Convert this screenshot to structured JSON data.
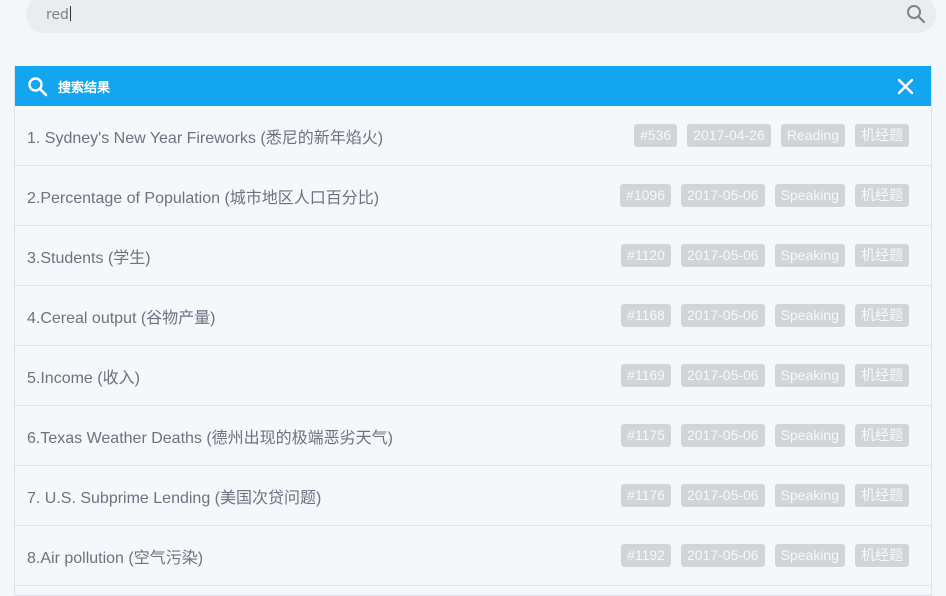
{
  "search": {
    "value": "red"
  },
  "panel": {
    "title": "搜索结果"
  },
  "results": [
    {
      "title": "1. Sydney's New Year Fireworks (悉尼的新年焰火)",
      "id": "#536",
      "date": "2017-04-26",
      "type": "Reading",
      "category": "机经题"
    },
    {
      "title": "2.Percentage of Population (城市地区人口百分比)",
      "id": "#1096",
      "date": "2017-05-06",
      "type": "Speaking",
      "category": "机经题"
    },
    {
      "title": "3.Students (学生)",
      "id": "#1120",
      "date": "2017-05-06",
      "type": "Speaking",
      "category": "机经题"
    },
    {
      "title": "4.Cereal output (谷物产量)",
      "id": "#1168",
      "date": "2017-05-06",
      "type": "Speaking",
      "category": "机经题"
    },
    {
      "title": "5.Income (收入)",
      "id": "#1169",
      "date": "2017-05-06",
      "type": "Speaking",
      "category": "机经题"
    },
    {
      "title": "6.Texas Weather Deaths (德州出现的极端恶劣天气)",
      "id": "#1175",
      "date": "2017-05-06",
      "type": "Speaking",
      "category": "机经题"
    },
    {
      "title": "7. U.S. Subprime Lending (美国次贷问题)",
      "id": "#1176",
      "date": "2017-05-06",
      "type": "Speaking",
      "category": "机经题"
    },
    {
      "title": "8.Air pollution (空气污染)",
      "id": "#1192",
      "date": "2017-05-06",
      "type": "Speaking",
      "category": "机经题"
    }
  ]
}
